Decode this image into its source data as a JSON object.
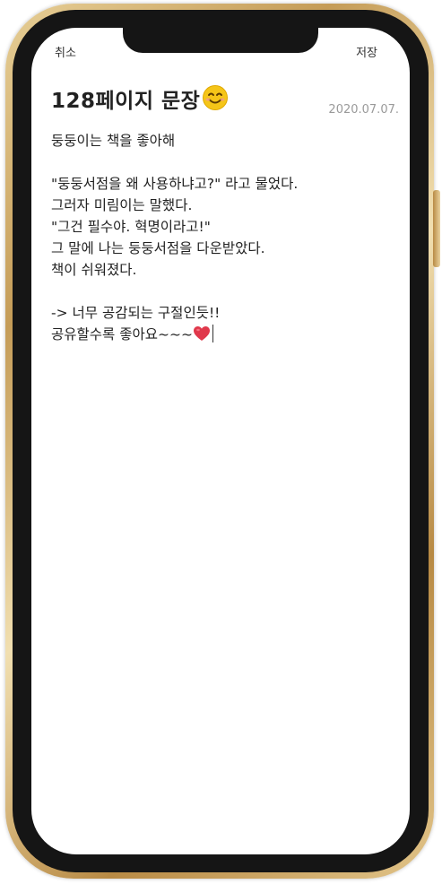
{
  "nav": {
    "cancel_label": "취소",
    "save_label": "저장"
  },
  "note": {
    "title": "128페이지 문장",
    "date": "2020.07.07.",
    "lines": [
      "둥둥이는 책을 좋아해",
      "",
      "\"둥둥서점을 왜 사용하냐고?\" 라고 물었다.",
      "그러자 미림이는 말했다.",
      "\"그건 필수야. 혁명이라고!\"",
      "그 말에 나는 둥둥서점을 다운받았다.",
      "책이 쉬워졌다.",
      "",
      "-> 너무 공감되는 구절인듯!!",
      "공유할수록 좋아요~~~"
    ]
  },
  "icons": {
    "title_emoji": "smiling-face-icon",
    "line_end": "red-heart-icon"
  },
  "colors": {
    "frame_gold": "#d4b06a",
    "frame_black": "#151515",
    "heart": "#e0384b",
    "emoji": "#f5c518"
  }
}
